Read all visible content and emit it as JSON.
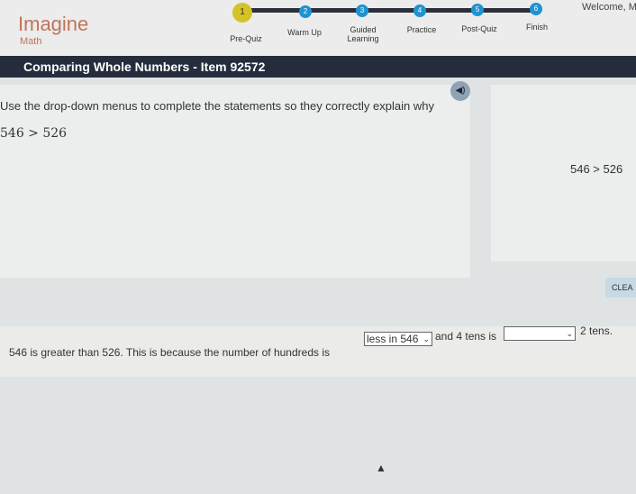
{
  "brand": {
    "name": "Imagine",
    "sub": "Math"
  },
  "welcome": "Welcome, M",
  "steps": [
    {
      "num": "1",
      "label": "Pre-Quiz",
      "active": true
    },
    {
      "num": "2",
      "label": "Warm Up"
    },
    {
      "num": "3",
      "label": "Guided Learning"
    },
    {
      "num": "4",
      "label": "Practice"
    },
    {
      "num": "5",
      "label": "Post-Quiz"
    },
    {
      "num": "6",
      "label": "Finish"
    }
  ],
  "title": "Comparing Whole Numbers - Item 92572",
  "question": {
    "instruction": "Use the drop-down menus to complete the statements so they correctly explain why",
    "expression": "546 > 526"
  },
  "side": {
    "expression": "546 > 526"
  },
  "clear_label": "CLEA",
  "answer": {
    "part1": "546 is greater than 526. This is because the number of hundreds is",
    "dropdown1": "less in 546",
    "part2": "and 4 tens is",
    "dropdown2": "",
    "part3": "2 tens."
  }
}
